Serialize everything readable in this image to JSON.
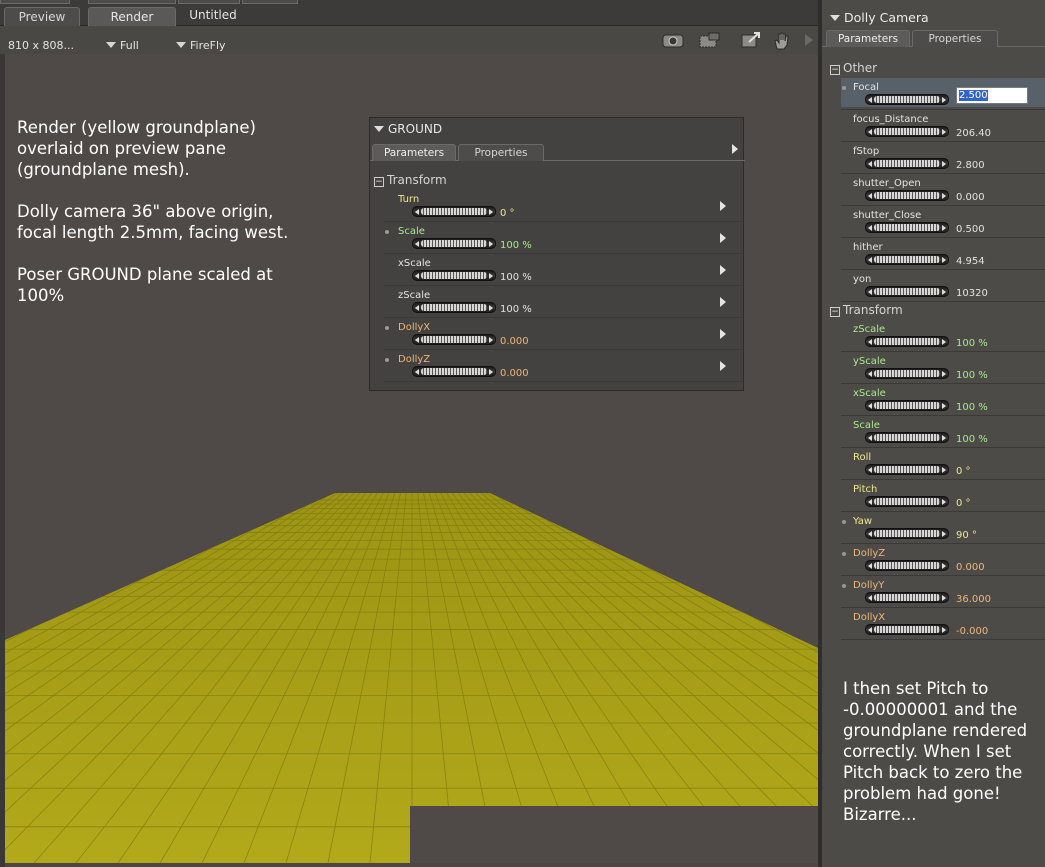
{
  "tabs": {
    "preview": "Preview",
    "render": "Render",
    "untitled": "Untitled"
  },
  "toolbar": {
    "resolution": "810 x 808...",
    "size_option": "Full",
    "renderer": "FireFly"
  },
  "overlay": {
    "p1": "Render (yellow groundplane) overlaid on preview pane (groundplane mesh).",
    "p2": "Dolly camera 36\" above origin, focal length 2.5mm, facing west.",
    "p3": "Poser GROUND plane scaled at 100%"
  },
  "ground_panel": {
    "title": "GROUND",
    "tab_parameters": "Parameters",
    "tab_properties": "Properties",
    "group": "Transform",
    "params": [
      {
        "label": "Turn",
        "value": "0 °",
        "label_color": "#f0e68c",
        "value_color": "#f0e68c",
        "dot": false
      },
      {
        "label": "Scale",
        "value": "100 %",
        "label_color": "#a8e88a",
        "value_color": "#a8e88a",
        "dot": true
      },
      {
        "label": "xScale",
        "value": "100 %",
        "label_color": "#e4e2df",
        "value_color": "#e4e2df",
        "dot": false
      },
      {
        "label": "zScale",
        "value": "100 %",
        "label_color": "#e4e2df",
        "value_color": "#e4e2df",
        "dot": false
      },
      {
        "label": "DollyX",
        "value": "0.000",
        "label_color": "#f0b47a",
        "value_color": "#f0b47a",
        "dot": true
      },
      {
        "label": "DollyZ",
        "value": "0.000",
        "label_color": "#f0b47a",
        "value_color": "#f0b47a",
        "dot": true
      }
    ]
  },
  "camera_panel": {
    "title": "Dolly Camera",
    "tab_parameters": "Parameters",
    "tab_properties": "Properties",
    "group_other": "Other",
    "group_transform": "Transform",
    "other_params": [
      {
        "label": "Focal",
        "value": "2.500",
        "label_color": "#e4e2df",
        "value_color": "#e4e2df",
        "dot": true,
        "editing": true
      },
      {
        "label": "focus_Distance",
        "value": "206.40",
        "label_color": "#e4e2df",
        "value_color": "#e4e2df",
        "dot": false
      },
      {
        "label": "fStop",
        "value": "2.800",
        "label_color": "#e4e2df",
        "value_color": "#e4e2df",
        "dot": false
      },
      {
        "label": "shutter_Open",
        "value": "0.000",
        "label_color": "#e4e2df",
        "value_color": "#e4e2df",
        "dot": false
      },
      {
        "label": "shutter_Close",
        "value": "0.500",
        "label_color": "#e4e2df",
        "value_color": "#e4e2df",
        "dot": false
      },
      {
        "label": "hither",
        "value": "4.954",
        "label_color": "#e4e2df",
        "value_color": "#e4e2df",
        "dot": false
      },
      {
        "label": "yon",
        "value": "10320",
        "label_color": "#e4e2df",
        "value_color": "#e4e2df",
        "dot": false
      }
    ],
    "transform_params": [
      {
        "label": "zScale",
        "value": "100 %",
        "label_color": "#a8e88a",
        "value_color": "#a8e88a",
        "dot": false
      },
      {
        "label": "yScale",
        "value": "100 %",
        "label_color": "#a8e88a",
        "value_color": "#a8e88a",
        "dot": false
      },
      {
        "label": "xScale",
        "value": "100 %",
        "label_color": "#a8e88a",
        "value_color": "#a8e88a",
        "dot": false
      },
      {
        "label": "Scale",
        "value": "100 %",
        "label_color": "#a8e88a",
        "value_color": "#a8e88a",
        "dot": false
      },
      {
        "label": "Roll",
        "value": "0 °",
        "label_color": "#f0e68c",
        "value_color": "#f0e68c",
        "dot": false
      },
      {
        "label": "Pitch",
        "value": "0 °",
        "label_color": "#f0e68c",
        "value_color": "#f0e68c",
        "dot": false
      },
      {
        "label": "Yaw",
        "value": "90 °",
        "label_color": "#f0e68c",
        "value_color": "#f0e68c",
        "dot": true
      },
      {
        "label": "DollyZ",
        "value": "0.000",
        "label_color": "#f0b47a",
        "value_color": "#f0b47a",
        "dot": true
      },
      {
        "label": "DollyY",
        "value": "36.000",
        "label_color": "#f0b47a",
        "value_color": "#f0b47a",
        "dot": true
      },
      {
        "label": "DollyX",
        "value": "-0.000",
        "label_color": "#f0b47a",
        "value_color": "#f0b47a",
        "dot": false
      }
    ]
  },
  "footnote": "I then set Pitch to -0.00000001 and the groundplane rendered correctly. When I set Pitch back to zero the problem had gone! Bizarre...",
  "colors": {
    "groundplane": "#a8a016",
    "viewport_bg": "#4f4a47",
    "panel_bg": "#4d4b48"
  },
  "icons": [
    "camera-icon",
    "render-settings-icon",
    "export-icon",
    "hand-icon",
    "play-icon"
  ]
}
